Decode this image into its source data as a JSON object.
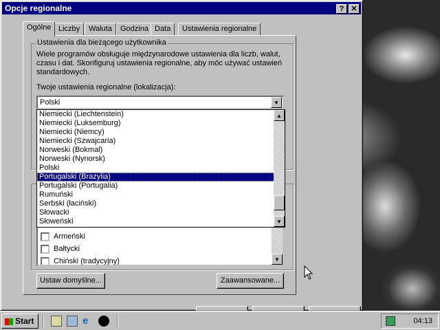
{
  "dialog": {
    "title": "Opcje regionalne",
    "help_label": "?",
    "close_label": "✕"
  },
  "tabs": [
    "Ogólne",
    "Liczby",
    "Waluta",
    "Godzina",
    "Data",
    "Ustawienia regionalne"
  ],
  "group_user": {
    "legend": "Ustawienia dla bieżącego użytkownika",
    "description": "Wiele programów obsługuje międzynarodowe ustawienia dla liczb, walut, czasu i dat. Skonfiguruj ustawienia regionalne, aby móc używać ustawień standardowych.",
    "locale_label": "Twoje ustawienia regionalne (lokalizacja):",
    "locale_value": "Polski"
  },
  "dropdown_items": [
    "Niemiecki (Liechtenstein)",
    "Niemiecki (Luksemburg)",
    "Niemiecki (Niemcy)",
    "Niemiecki (Szwajcaria)",
    "Norweski (Bokmal)",
    "Norweski (Nynorsk)",
    "Polski",
    "Portugalski (Brazylia)",
    "Portugalski (Portugalia)",
    "Rumuński",
    "Serbski (łaciński)",
    "Słowacki",
    "Słoweński"
  ],
  "dropdown_selected": "Portugalski (Brazylia)",
  "languages": [
    "Armeński",
    "Bałtycki",
    "Chiński (tradycyjny)"
  ],
  "buttons": {
    "default": "Ustaw domyślne...",
    "advanced": "Zaawansowane..."
  },
  "taskbar": {
    "start_label": "Start",
    "clock": "04:13"
  },
  "colors": {
    "titlebar": "#000080",
    "face": "#c0c0c0",
    "selection": "#000080"
  }
}
